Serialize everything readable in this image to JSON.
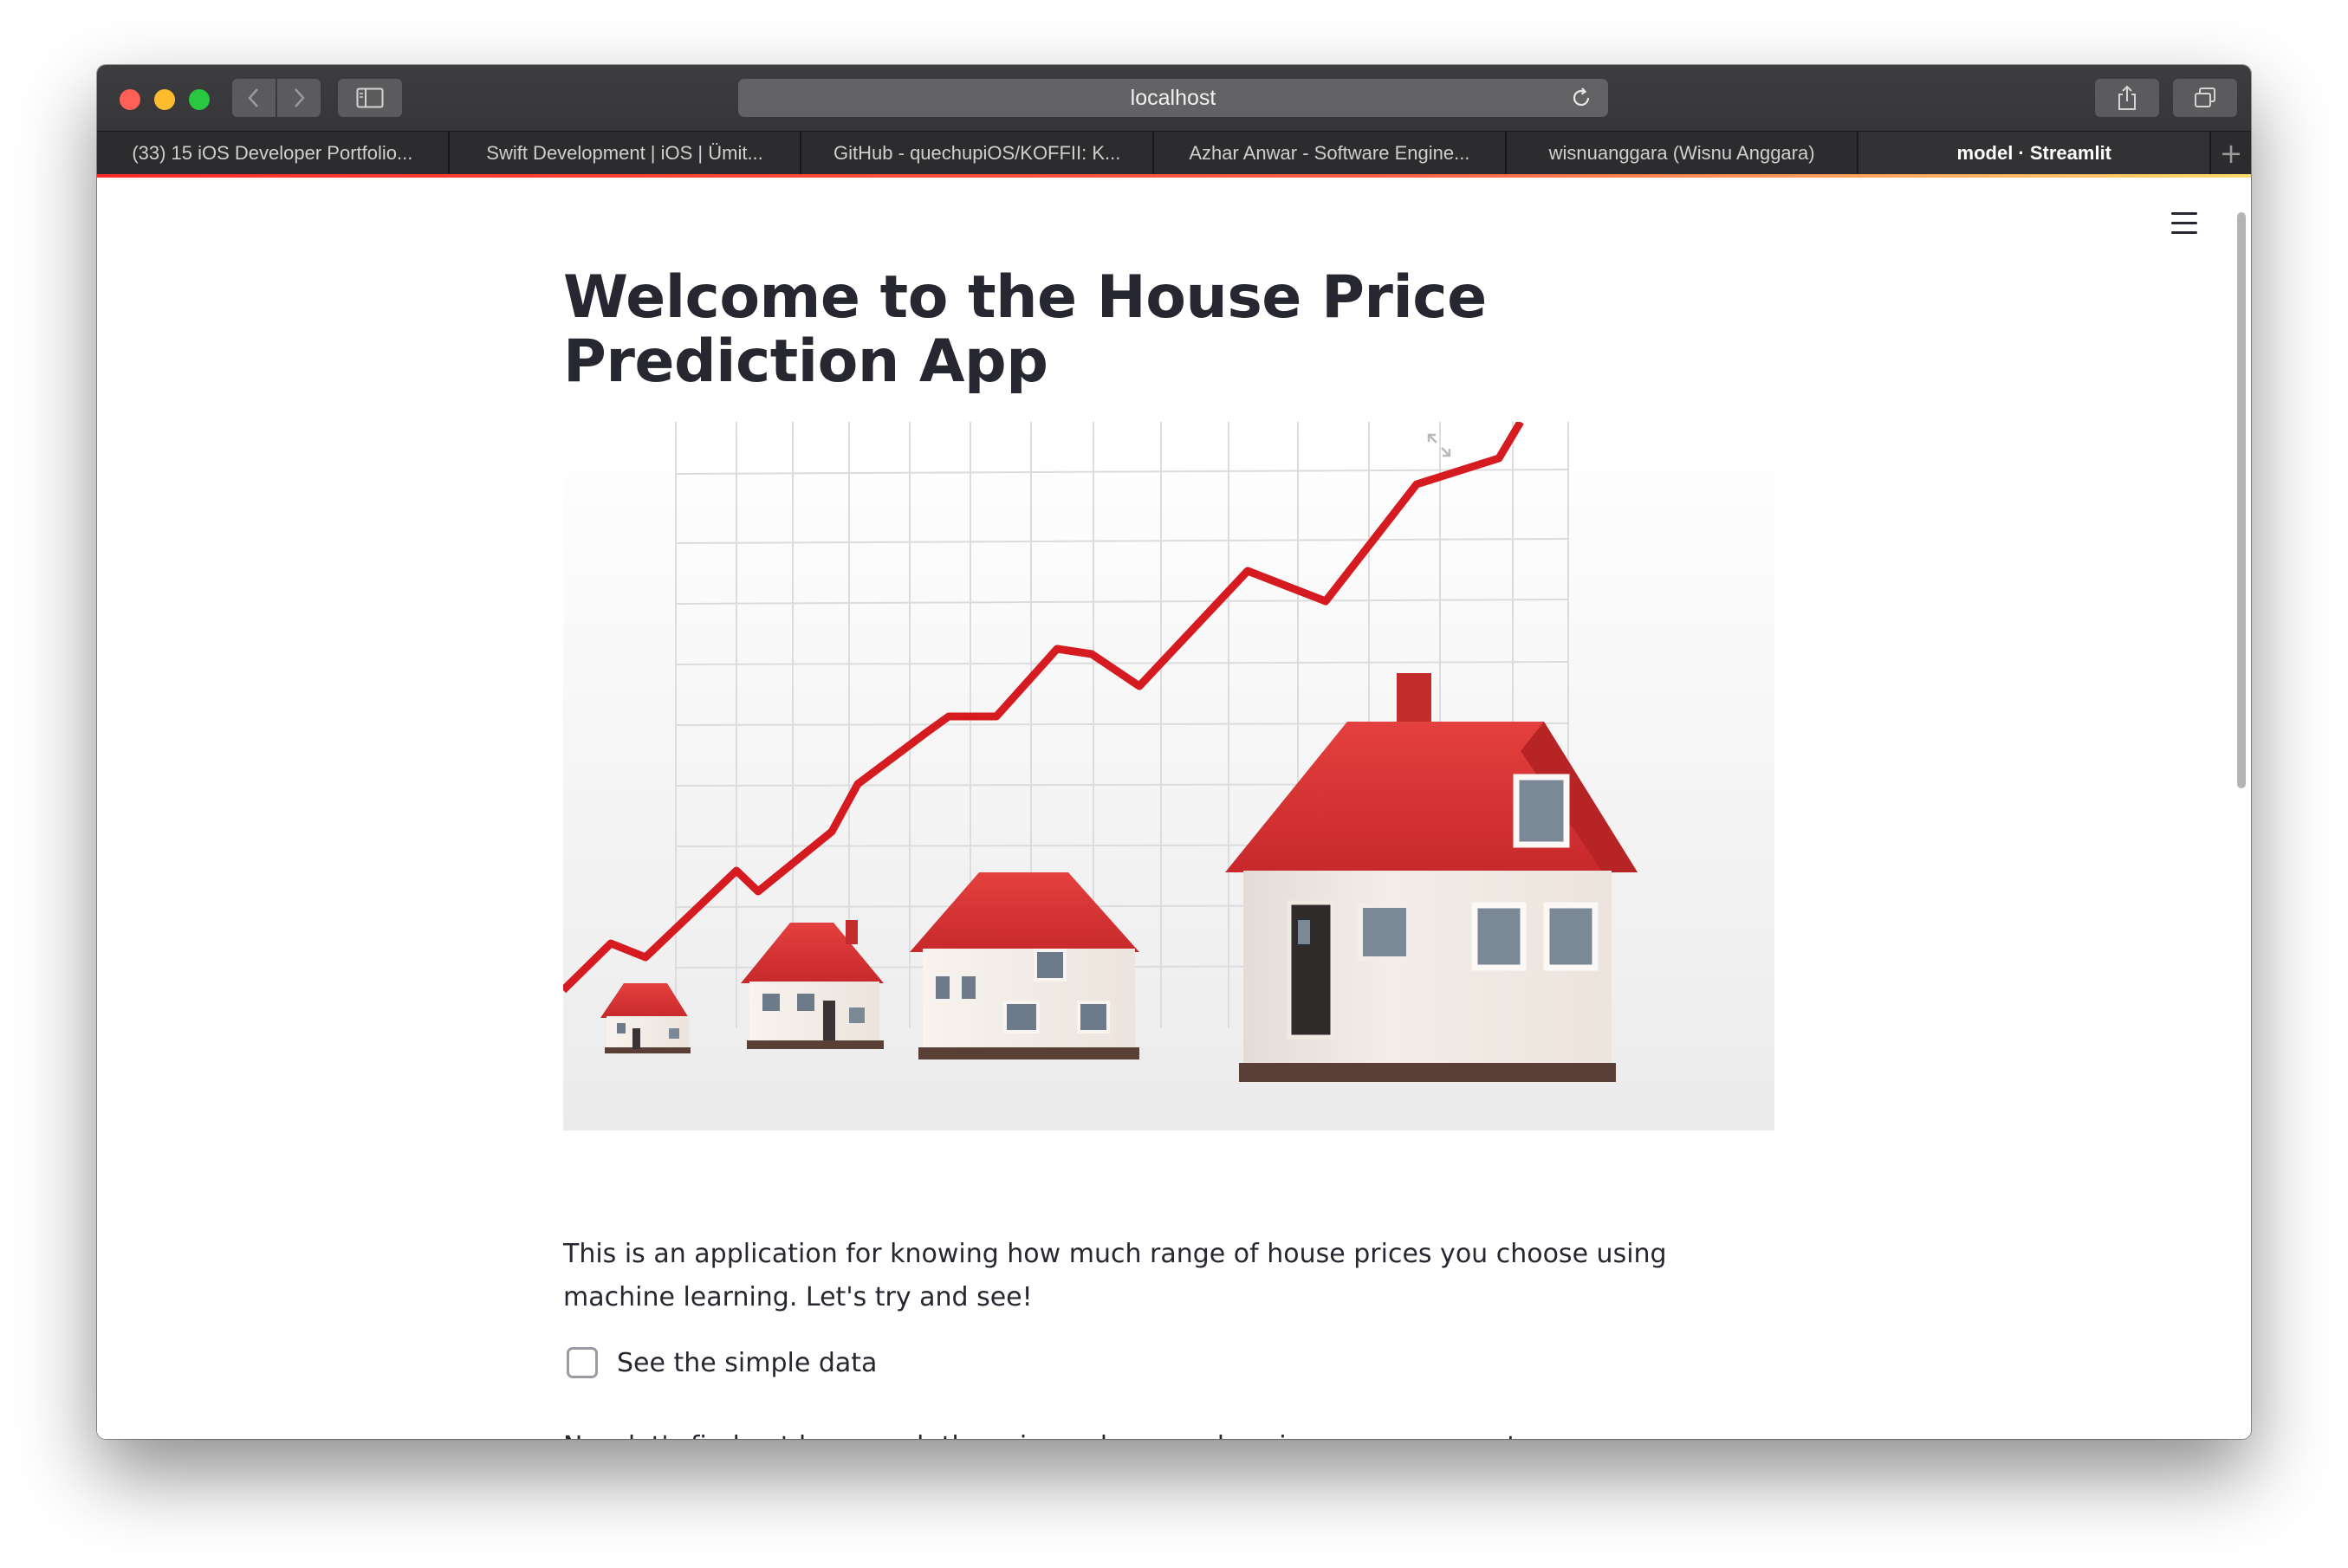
{
  "browser": {
    "url": "localhost",
    "tabs": [
      {
        "label": "(33) 15 iOS Developer Portfolio..."
      },
      {
        "label": "Swift Development | iOS | Ümit..."
      },
      {
        "label": "GitHub - quechupiOS/KOFFII: K..."
      },
      {
        "label": "Azhar Anwar - Software Engine..."
      },
      {
        "label": "wisnuanggara (Wisnu Anggara)"
      },
      {
        "label": "model · Streamlit"
      }
    ],
    "new_tab_label": "+",
    "accent_colors": [
      "#ff2b2b",
      "#ffd96b"
    ]
  },
  "page": {
    "title": "Welcome to the House Price Prediction App",
    "description": "This is an application for knowing how much range of house prices you choose using machine learning. Let's try and see!",
    "checkbox_label": "See the simple data",
    "checkbox_checked": false,
    "description2": "Now let's find out how much the prices when we choosing some parameters."
  },
  "icons": {
    "hamburger": "menu-icon",
    "expand": "fullscreen-expand-icon"
  }
}
